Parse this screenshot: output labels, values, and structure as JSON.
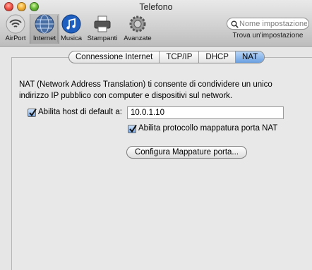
{
  "window": {
    "title": "Telefono"
  },
  "toolbar": {
    "items": [
      {
        "label": "AirPort",
        "icon": "airport-wifi-icon"
      },
      {
        "label": "Internet",
        "icon": "internet-globe-icon",
        "selected": true
      },
      {
        "label": "Musica",
        "icon": "music-note-icon"
      },
      {
        "label": "Stampanti",
        "icon": "printer-icon"
      },
      {
        "label": "Avanzate",
        "icon": "gear-icon"
      }
    ],
    "search": {
      "placeholder": "Nome impostazione",
      "caption": "Trova un'impostazione"
    }
  },
  "tabs": [
    {
      "label": "Connessione Internet",
      "active": false
    },
    {
      "label": "TCP/IP",
      "active": false
    },
    {
      "label": "DHCP",
      "active": false
    },
    {
      "label": "NAT",
      "active": true
    }
  ],
  "nat": {
    "description_line1": "NAT (Network Address Translation) ti consente di condividere un unico",
    "description_line2": "indirizzo IP pubblico con computer e dispositivi sul network.",
    "default_host_label": "Abilita host di default a:",
    "default_host_checked": true,
    "default_host_value": "10.0.1.10",
    "port_mapping_label": "Abilita protocollo mappatura porta NAT",
    "port_mapping_checked": true,
    "configure_button": "Configura Mappature porta..."
  },
  "colors": {
    "tab_active": "#6aa0e2",
    "checkbox": "#7aa9e6"
  }
}
